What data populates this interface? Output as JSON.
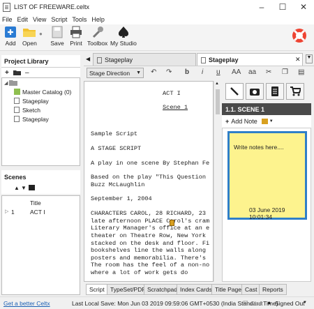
{
  "window": {
    "title": "LIST OF FREEWARE.celtx"
  },
  "menu": [
    "File",
    "Edit",
    "View",
    "Script",
    "Tools",
    "Help"
  ],
  "toolbar": {
    "add": "Add",
    "open": "Open",
    "save": "Save",
    "print": "Print",
    "toolbox": "Toolbox",
    "my_studio": "My Studio"
  },
  "project_library": {
    "title": "Project Library",
    "items": [
      "Master Catalog (0)",
      "Stageplay",
      "Sketch",
      "Stageplay"
    ]
  },
  "scenes": {
    "title": "Scenes",
    "column_title": "Title",
    "rows": [
      {
        "num": "1",
        "title": "ACT I"
      }
    ]
  },
  "editor": {
    "tabs": [
      "Stageplay",
      "Stageplay"
    ],
    "element_select": "Stage Direction",
    "script_lines": [
      "ACT I",
      "Scene 1",
      "Sample Script",
      "A STAGE SCRIPT",
      "A play in one scene By Stephan Fe",
      "Based on the play \"This Question",
      "Buzz McLaughlin",
      "September 1, 2004",
      "CHARACTERS CAROL, 28 RICHARD, 23",
      "late afternoon PLACE Carol's cram",
      "Literary Manager's office at an e",
      "theater on Theatre Row, New York",
      "stacked on the desk and floor. Fi",
      "bookshelves line the walls along",
      "posters and memorabilia. There's",
      "The room has the feel of a non-no",
      "where a lot of work gets do"
    ],
    "bottom_tabs": [
      "Script",
      "TypeSet/PDF",
      "Scratchpad",
      "Index Cards",
      "Title Page",
      "Cast",
      "Reports"
    ]
  },
  "notes": {
    "scene_header": "1.1. SCENE 1",
    "add_note": "Add Note",
    "note_text": "Write notes here....",
    "note_date": "03 June 2019 10:01:34"
  },
  "status": {
    "link": "Get a better Celtx",
    "last_save": "Last Local Save: Mon Jun 03 2019 09:59:06 GMT+0530 (India Standard Time)",
    "chat": "Chat",
    "signed_out": "Signed Out"
  },
  "colors": {
    "note_yellow": "#fdf38e",
    "note_border": "#2f7fc8",
    "link_blue": "#1a5fb4",
    "scene_header_bg": "#4a4a4a"
  }
}
